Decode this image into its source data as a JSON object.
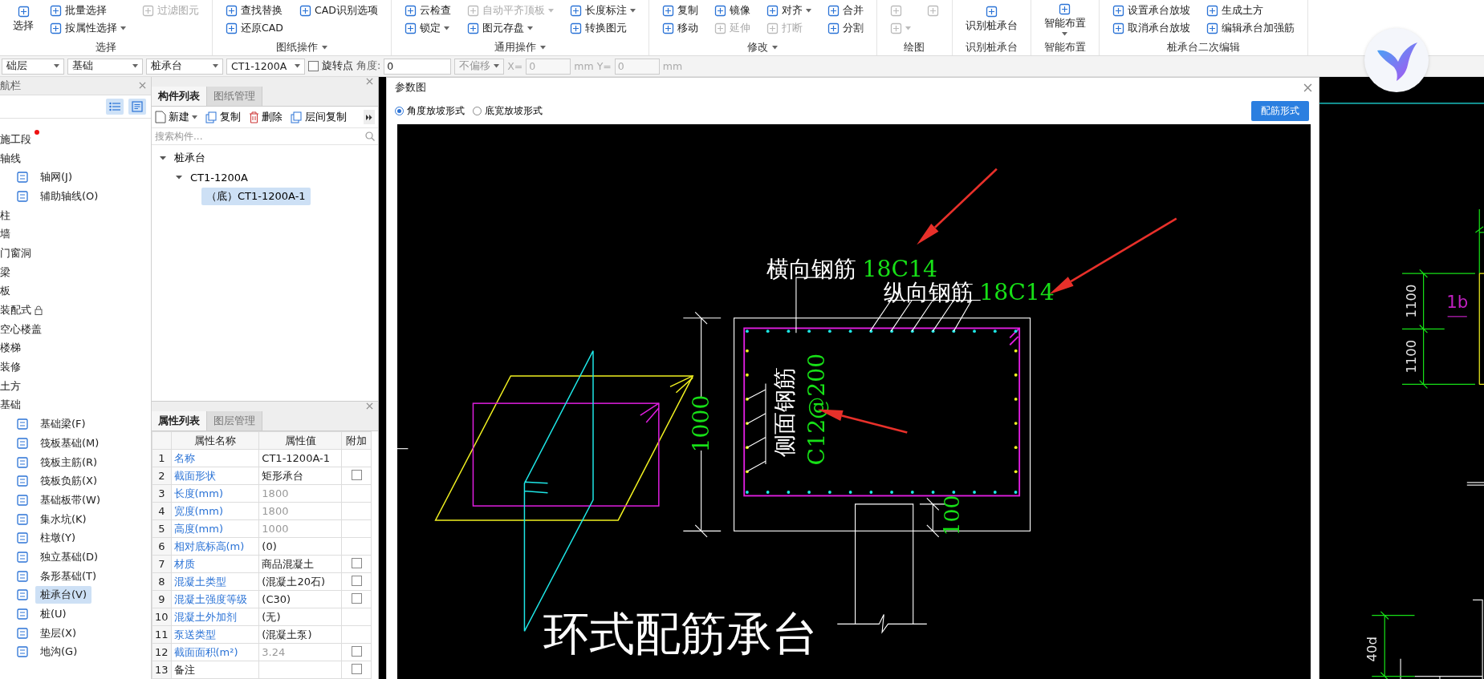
{
  "ribbon": {
    "groups": [
      {
        "title": "选择",
        "menu": false,
        "items": [
          {
            "kind": "large",
            "label": "选择",
            "disabled": false,
            "dropdown": false
          },
          {
            "kind": "small",
            "label": "批量选择",
            "disabled": false,
            "dropdown": false
          },
          {
            "kind": "small",
            "label": "按属性选择",
            "disabled": false,
            "dropdown": true
          },
          {
            "kind": "small",
            "label": "过滤图元",
            "disabled": true,
            "dropdown": false
          }
        ]
      },
      {
        "title": "图纸操作",
        "menu": true,
        "items": [
          {
            "kind": "small",
            "label": "查找替换",
            "disabled": false,
            "dropdown": false
          },
          {
            "kind": "small",
            "label": "还原CAD",
            "disabled": false,
            "dropdown": false
          },
          {
            "kind": "small",
            "label": "CAD识别选项",
            "disabled": false,
            "dropdown": false
          }
        ]
      },
      {
        "title": "通用操作",
        "menu": true,
        "items": [
          {
            "kind": "small",
            "label": "云检查",
            "disabled": false,
            "dropdown": false
          },
          {
            "kind": "small",
            "label": "锁定",
            "disabled": false,
            "dropdown": true
          },
          {
            "kind": "small",
            "label": "自动平齐顶板",
            "disabled": true,
            "dropdown": true
          },
          {
            "kind": "small",
            "label": "图元存盘",
            "disabled": false,
            "dropdown": true
          },
          {
            "kind": "small",
            "label": "长度标注",
            "disabled": false,
            "dropdown": true
          },
          {
            "kind": "small",
            "label": "转换图元",
            "disabled": false,
            "dropdown": false
          }
        ]
      },
      {
        "title": "修改",
        "menu": true,
        "items": [
          {
            "kind": "small",
            "label": "复制",
            "disabled": false,
            "dropdown": false
          },
          {
            "kind": "small",
            "label": "移动",
            "disabled": false,
            "dropdown": false
          },
          {
            "kind": "small",
            "label": "镜像",
            "disabled": false,
            "dropdown": false
          },
          {
            "kind": "small",
            "label": "延伸",
            "disabled": true,
            "dropdown": false
          },
          {
            "kind": "small",
            "label": "对齐",
            "disabled": false,
            "dropdown": true
          },
          {
            "kind": "small",
            "label": "打断",
            "disabled": true,
            "dropdown": false
          },
          {
            "kind": "small",
            "label": "合并",
            "disabled": false,
            "dropdown": false
          },
          {
            "kind": "small",
            "label": "分割",
            "disabled": false,
            "dropdown": false
          }
        ]
      },
      {
        "title": "绘图",
        "menu": false,
        "items": [
          {
            "kind": "icon",
            "disabled": true,
            "dropdown": false
          },
          {
            "kind": "icon",
            "disabled": true,
            "dropdown": true
          },
          {
            "kind": "icon",
            "disabled": true,
            "dropdown": false
          }
        ]
      },
      {
        "title": "识别桩承台",
        "menu": false,
        "items": [
          {
            "kind": "large",
            "label": "识别桩承台",
            "disabled": false,
            "dropdown": false
          }
        ]
      },
      {
        "title": "智能布置",
        "menu": false,
        "items": [
          {
            "kind": "large",
            "label": "智能布置",
            "disabled": false,
            "dropdown": true
          }
        ]
      },
      {
        "title": "桩承台二次编辑",
        "menu": false,
        "items": [
          {
            "kind": "small",
            "label": "设置承台放坡",
            "disabled": false,
            "dropdown": false
          },
          {
            "kind": "small",
            "label": "取消承台放坡",
            "disabled": false,
            "dropdown": false
          },
          {
            "kind": "small",
            "label": "生成土方",
            "disabled": false,
            "dropdown": false
          },
          {
            "kind": "small",
            "label": "编辑承台加强筋",
            "disabled": false,
            "dropdown": false
          }
        ]
      }
    ]
  },
  "toolbar": {
    "selectors": [
      {
        "value": "础层"
      },
      {
        "value": "基础"
      },
      {
        "value": "桩承台"
      },
      {
        "value": "CT1-1200A"
      }
    ],
    "rotate_point": {
      "label": "旋转点",
      "checked": false
    },
    "angle": {
      "label": "角度:",
      "value": "0"
    },
    "offset": {
      "value": "不偏移",
      "disabled": true
    },
    "x": {
      "label": "X=",
      "value": "0",
      "unit": "mm",
      "disabled": true
    },
    "y": {
      "label": "Y=",
      "value": "0",
      "unit": "mm",
      "disabled": true
    }
  },
  "nav": {
    "title": "航栏",
    "items": [
      {
        "label": "施工段",
        "flagged": true,
        "locked": false,
        "selected": false
      },
      {
        "label": "轴线",
        "flagged": false,
        "locked": false,
        "selected": false,
        "children": [
          {
            "label": "轴网(J)",
            "selected": false
          },
          {
            "label": "辅助轴线(O)",
            "selected": false
          }
        ]
      },
      {
        "label": "柱",
        "flagged": false,
        "locked": false,
        "selected": false
      },
      {
        "label": "墙",
        "flagged": false,
        "locked": false,
        "selected": false
      },
      {
        "label": "门窗洞",
        "flagged": false,
        "locked": false,
        "selected": false
      },
      {
        "label": "梁",
        "flagged": false,
        "locked": false,
        "selected": false
      },
      {
        "label": "板",
        "flagged": false,
        "locked": false,
        "selected": false
      },
      {
        "label": "装配式",
        "flagged": false,
        "locked": true,
        "selected": false
      },
      {
        "label": "空心楼盖",
        "flagged": false,
        "locked": false,
        "selected": false
      },
      {
        "label": "楼梯",
        "flagged": false,
        "locked": false,
        "selected": false
      },
      {
        "label": "装修",
        "flagged": false,
        "locked": false,
        "selected": false
      },
      {
        "label": "土方",
        "flagged": false,
        "locked": false,
        "selected": false
      },
      {
        "label": "基础",
        "flagged": false,
        "locked": false,
        "selected": false,
        "children": [
          {
            "label": "基础梁(F)",
            "selected": false
          },
          {
            "label": "筏板基础(M)",
            "selected": false
          },
          {
            "label": "筏板主筋(R)",
            "selected": false
          },
          {
            "label": "筏板负筋(X)",
            "selected": false
          },
          {
            "label": "基础板带(W)",
            "selected": false
          },
          {
            "label": "集水坑(K)",
            "selected": false
          },
          {
            "label": "柱墩(Y)",
            "selected": false
          },
          {
            "label": "独立基础(D)",
            "selected": false
          },
          {
            "label": "条形基础(T)",
            "selected": false
          },
          {
            "label": "桩承台(V)",
            "selected": true
          },
          {
            "label": "桩(U)",
            "selected": false
          },
          {
            "label": "垫层(X)",
            "selected": false
          },
          {
            "label": "地沟(G)",
            "selected": false
          }
        ]
      }
    ]
  },
  "components": {
    "tabs": [
      {
        "label": "构件列表",
        "selected": true
      },
      {
        "label": "图纸管理",
        "selected": false
      }
    ],
    "actions": [
      {
        "label": "新建",
        "dropdown": true
      },
      {
        "label": "复制",
        "dropdown": false
      },
      {
        "label": "删除",
        "dropdown": false
      },
      {
        "label": "层间复制",
        "dropdown": false
      }
    ],
    "search": {
      "placeholder": "搜索构件..."
    },
    "tree": [
      {
        "label": "桩承台",
        "expanded": true,
        "selected": false,
        "children": [
          {
            "label": "CT1-1200A",
            "expanded": true,
            "selected": false,
            "children": [
              {
                "label": "（底）CT1-1200A-1",
                "selected": true
              }
            ]
          }
        ]
      }
    ]
  },
  "properties": {
    "tabs": [
      {
        "label": "属性列表",
        "selected": true
      },
      {
        "label": "图层管理",
        "selected": false
      }
    ],
    "columns": [
      "属性名称",
      "属性值",
      "附加"
    ],
    "rows": [
      {
        "index": "1",
        "name": "名称",
        "value": "CT1-1200A-1",
        "public": true,
        "readonly": false
      },
      {
        "index": "2",
        "name": "截面形状",
        "value": "矩形承台",
        "public": true,
        "readonly": false,
        "attached": false
      },
      {
        "index": "3",
        "name": "长度(mm)",
        "value": "1800",
        "public": true,
        "readonly": true
      },
      {
        "index": "4",
        "name": "宽度(mm)",
        "value": "1800",
        "public": true,
        "readonly": true
      },
      {
        "index": "5",
        "name": "高度(mm)",
        "value": "1000",
        "public": true,
        "readonly": true
      },
      {
        "index": "6",
        "name": "相对底标高(m)",
        "value": "(0)",
        "public": true,
        "readonly": false
      },
      {
        "index": "7",
        "name": "材质",
        "value": "商品混凝土",
        "public": true,
        "readonly": false,
        "attached": false
      },
      {
        "index": "8",
        "name": "混凝土类型",
        "value": "(混凝土20石)",
        "public": true,
        "readonly": false,
        "attached": false
      },
      {
        "index": "9",
        "name": "混凝土强度等级",
        "value": "(C30)",
        "public": true,
        "readonly": false,
        "attached": false
      },
      {
        "index": "10",
        "name": "混凝土外加剂",
        "value": "(无)",
        "public": true,
        "readonly": false
      },
      {
        "index": "11",
        "name": "泵送类型",
        "value": "(混凝土泵)",
        "public": true,
        "readonly": false
      },
      {
        "index": "12",
        "name": "截面面积(m²)",
        "value": "3.24",
        "public": true,
        "readonly": true,
        "attached": false
      },
      {
        "index": "13",
        "name": "备注",
        "value": "",
        "public": false,
        "attached": false
      }
    ]
  },
  "dialog": {
    "title": "参数图",
    "options": [
      {
        "label": "角度放坡形式",
        "selected": true
      },
      {
        "label": "底宽放坡形式",
        "selected": false
      }
    ],
    "button": "配筋形式",
    "drawing": {
      "top_rebar_label": "横向钢筋",
      "top_rebar_spec": "18C14",
      "long_rebar_label": "纵向钢筋",
      "long_rebar_spec": "18C14",
      "side_rebar_label": "侧面钢筋",
      "side_rebar_spec": "C12@200",
      "height_dim": "1000",
      "cover_dim": "100",
      "title": "环式配筋承台"
    }
  },
  "background_drawing": {
    "dims": [
      "1100",
      "1100"
    ],
    "tag": "1b",
    "anchor_dim": "40d"
  }
}
